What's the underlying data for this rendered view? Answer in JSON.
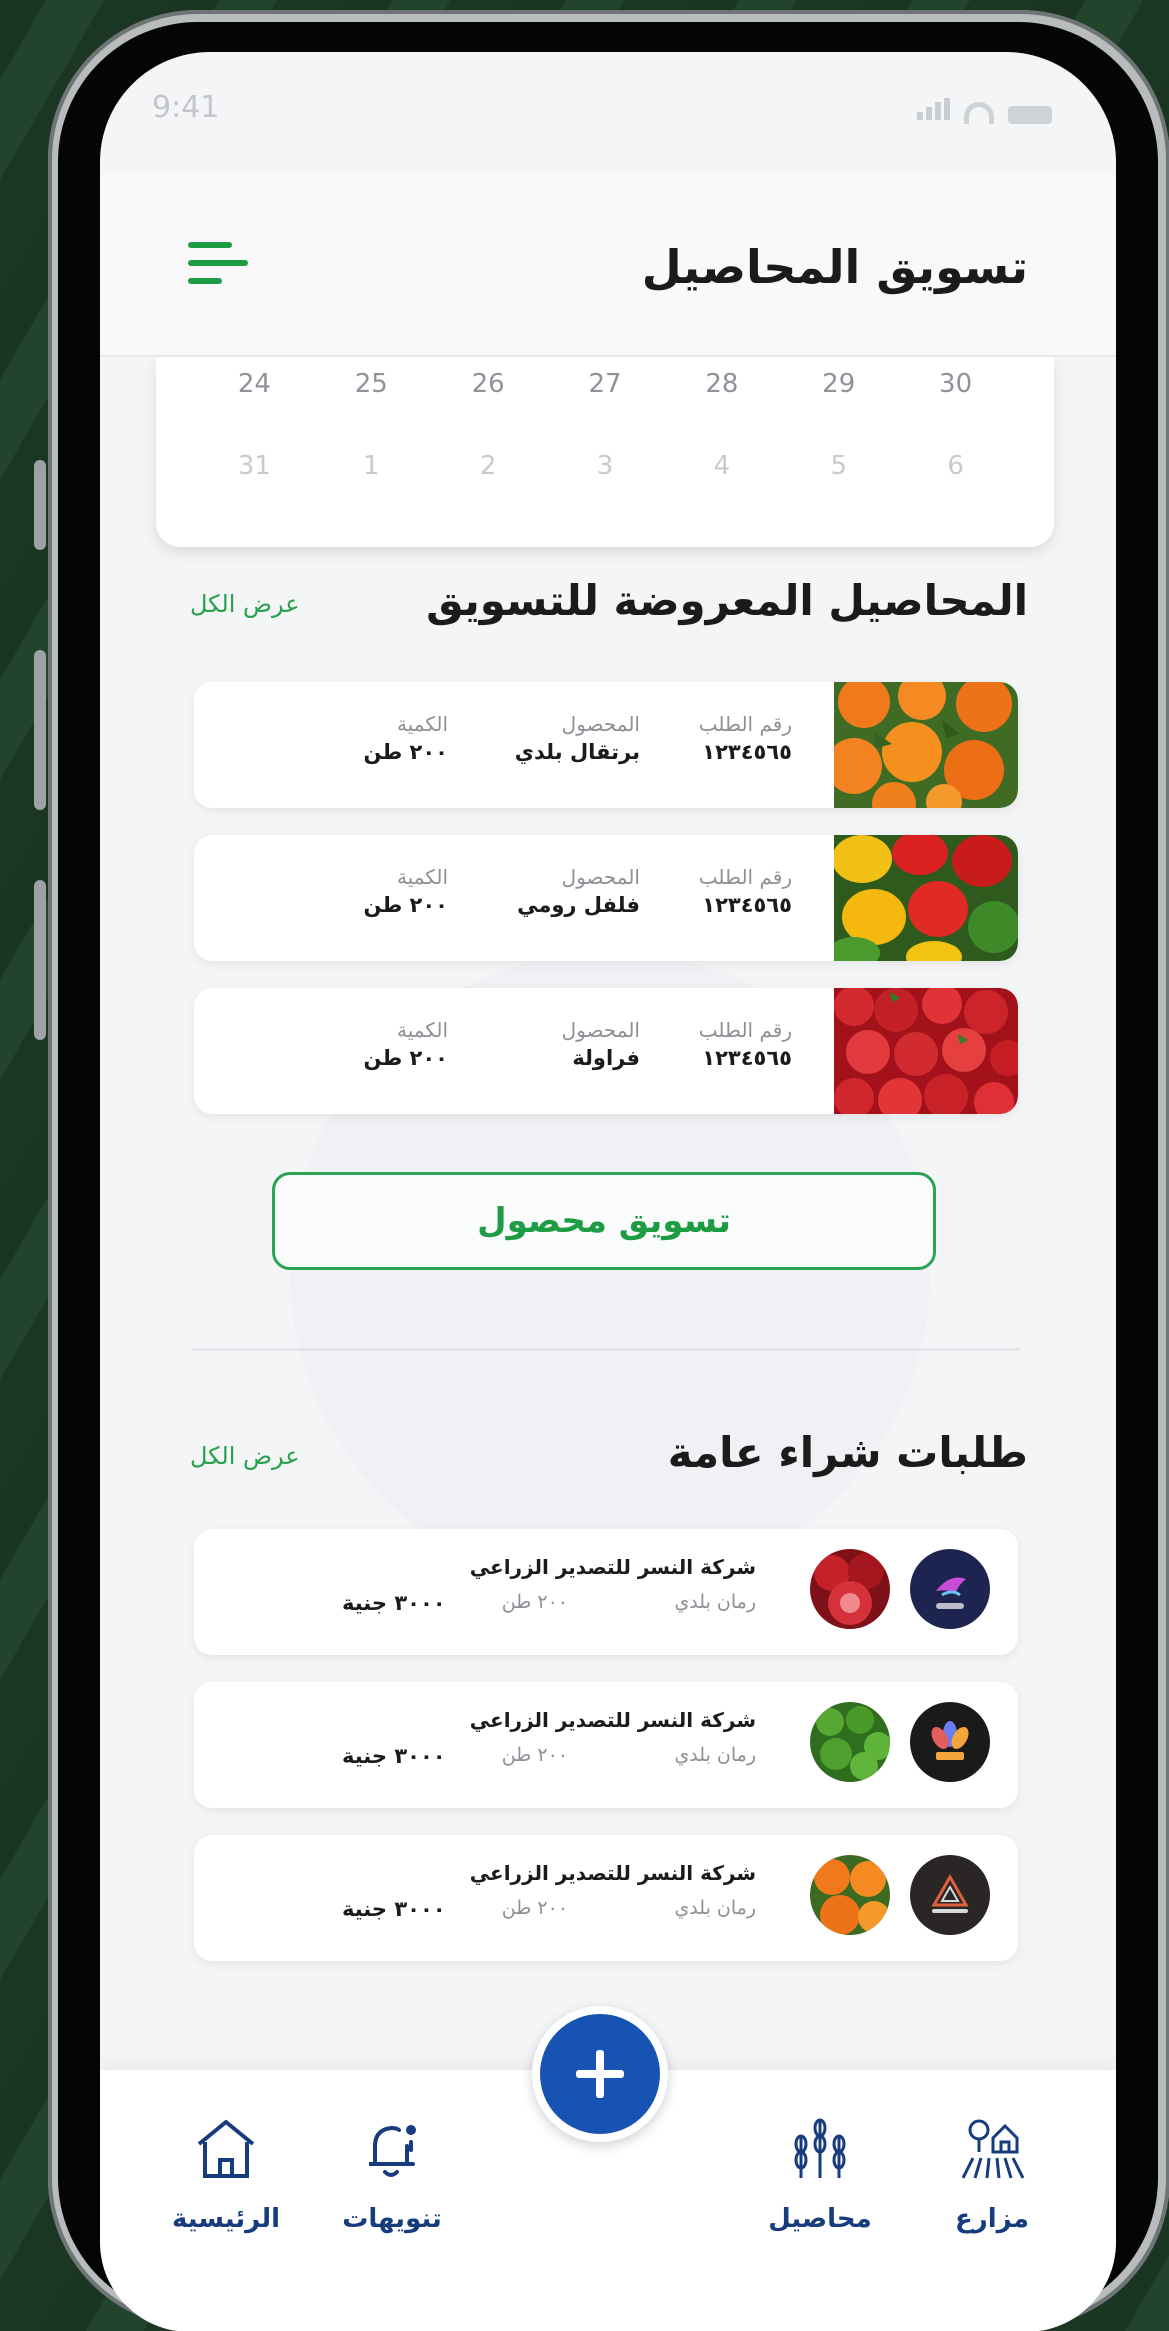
{
  "status_bar": {
    "time": "9:41"
  },
  "header": {
    "title": "تسويق المحاصيل",
    "menu_icon": "hamburger-menu-icon"
  },
  "calendar": {
    "rows": [
      [
        "24",
        "25",
        "26",
        "27",
        "28",
        "29",
        "30"
      ],
      [
        "31",
        "1",
        "2",
        "3",
        "4",
        "5",
        "6"
      ]
    ]
  },
  "offered_crops": {
    "title": "المحاصيل المعروضة للتسويق",
    "view_all": "عرض الكل",
    "items": [
      {
        "order_label": "رقم الطلب",
        "order_no": "١٢٣٤٥٦٥",
        "product_label": "المحصول",
        "product": "برتقال بلدي",
        "qty_label": "الكمية",
        "qty": "٢٠٠ طن",
        "image": "oranges"
      },
      {
        "order_label": "رقم الطلب",
        "order_no": "١٢٣٤٥٦٥",
        "product_label": "المحصول",
        "product": "فلفل رومي",
        "qty_label": "الكمية",
        "qty": "٢٠٠ طن",
        "image": "bell-peppers"
      },
      {
        "order_label": "رقم الطلب",
        "order_no": "١٢٣٤٥٦٥",
        "product_label": "المحصول",
        "product": "فراولة",
        "qty_label": "الكمية",
        "qty": "٢٠٠ طن",
        "image": "strawberries"
      }
    ],
    "market_button": "تسويق محصول"
  },
  "purchase_requests": {
    "title": "طلبات شراء عامة",
    "view_all": "عرض الكل",
    "items": [
      {
        "company": "شركة النسر للتصدير الزراعي",
        "crop": "رمان بلدي",
        "qty": "٢٠٠ طن",
        "price": "٣٠٠٠ جنية",
        "logo": "bird-logo-icon",
        "image": "pomegranates"
      },
      {
        "company": "شركة النسر للتصدير الزراعي",
        "crop": "رمان بلدي",
        "qty": "٢٠٠ طن",
        "price": "٣٠٠٠ جنية",
        "logo": "lotus-logo-icon",
        "image": "green-peppers"
      },
      {
        "company": "شركة النسر للتصدير الزراعي",
        "crop": "رمان بلدي",
        "qty": "٢٠٠ طن",
        "price": "٣٠٠٠ جنية",
        "logo": "vipever-logo-icon",
        "image": "oranges"
      }
    ]
  },
  "bottom_nav": {
    "items": [
      {
        "label": "الرئيسية",
        "icon": "home-icon"
      },
      {
        "label": "تنويهات",
        "icon": "bell-icon"
      },
      {
        "label": "محاصيل",
        "icon": "wheat-icon"
      },
      {
        "label": "مزارع",
        "icon": "farm-icon"
      }
    ],
    "fab_icon": "plus-icon"
  },
  "colors": {
    "accent_green": "#1e9c44",
    "nav_blue": "#173c7e",
    "fab_blue": "#1653b3"
  }
}
